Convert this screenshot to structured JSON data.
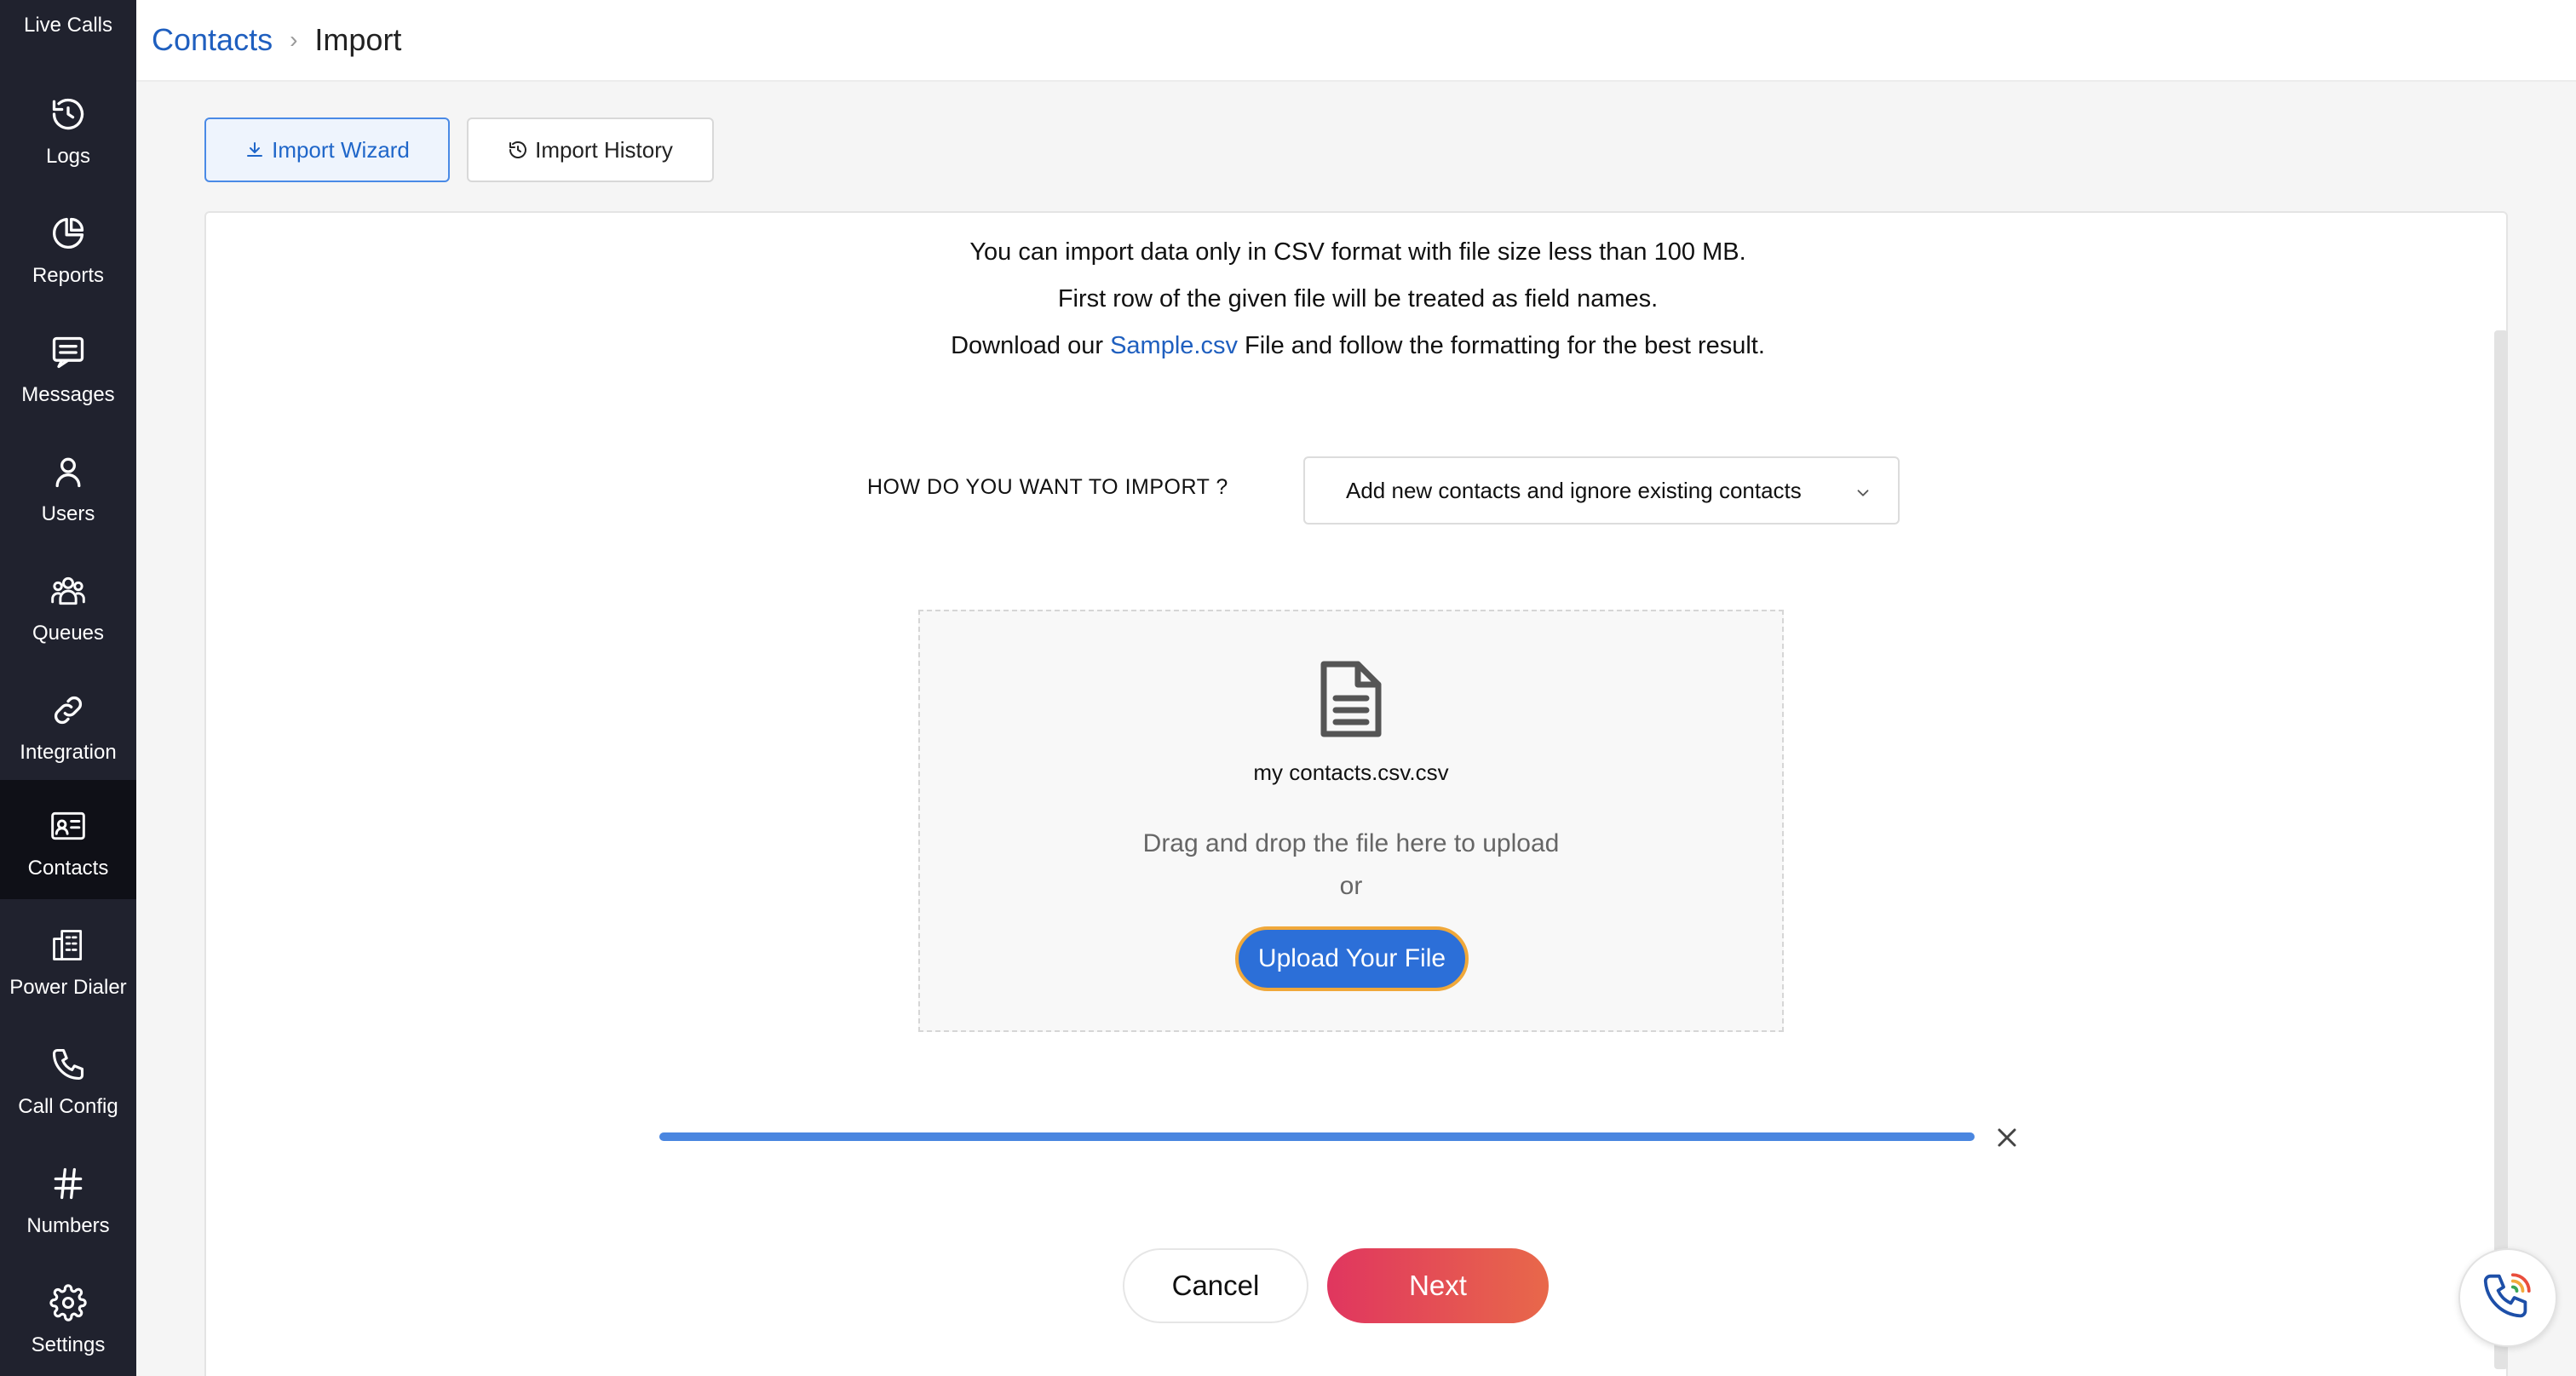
{
  "sidebar": {
    "items": [
      {
        "label": "Live Calls",
        "icon": "live-calls-icon"
      },
      {
        "label": "Logs",
        "icon": "history-icon"
      },
      {
        "label": "Reports",
        "icon": "pie-chart-icon"
      },
      {
        "label": "Messages",
        "icon": "message-icon"
      },
      {
        "label": "Users",
        "icon": "user-icon"
      },
      {
        "label": "Queues",
        "icon": "group-icon"
      },
      {
        "label": "Integration",
        "icon": "link-icon"
      },
      {
        "label": "Contacts",
        "icon": "contact-card-icon",
        "active": true
      },
      {
        "label": "Power Dialer",
        "icon": "building-icon"
      },
      {
        "label": "Call Config",
        "icon": "phone-icon"
      },
      {
        "label": "Numbers",
        "icon": "hash-icon"
      },
      {
        "label": "Settings",
        "icon": "gear-icon"
      }
    ]
  },
  "header": {
    "breadcrumb_parent": "Contacts",
    "breadcrumb_current": "Import"
  },
  "tabs": [
    {
      "label": "Import Wizard",
      "icon": "download-icon",
      "active": true
    },
    {
      "label": "Import History",
      "icon": "history-icon",
      "active": false
    }
  ],
  "info": {
    "line1": "You can import data only in CSV format with file size less than 100 MB.",
    "line2": "First row of the given file will be treated as field names.",
    "line3_prefix": "Download our ",
    "line3_link": "Sample.csv",
    "line3_suffix": " File and follow the formatting for the best result."
  },
  "import_mode": {
    "label": "HOW DO YOU WANT TO IMPORT ?",
    "selected": "Add new contacts and ignore existing contacts"
  },
  "dropzone": {
    "file_name": "my contacts.csv.csv",
    "drag_text": "Drag and drop the file here to upload",
    "or_text": "or",
    "upload_label": "Upload Your File"
  },
  "upload_progress": 1.0,
  "actions": {
    "cancel_label": "Cancel",
    "next_label": "Next"
  },
  "colors": {
    "sidebar_bg": "#20222e",
    "accent_blue": "#2c6fd8",
    "link_blue": "#1f5fbf",
    "next_gradient_start": "#e0365f",
    "next_gradient_end": "#e8684a"
  }
}
